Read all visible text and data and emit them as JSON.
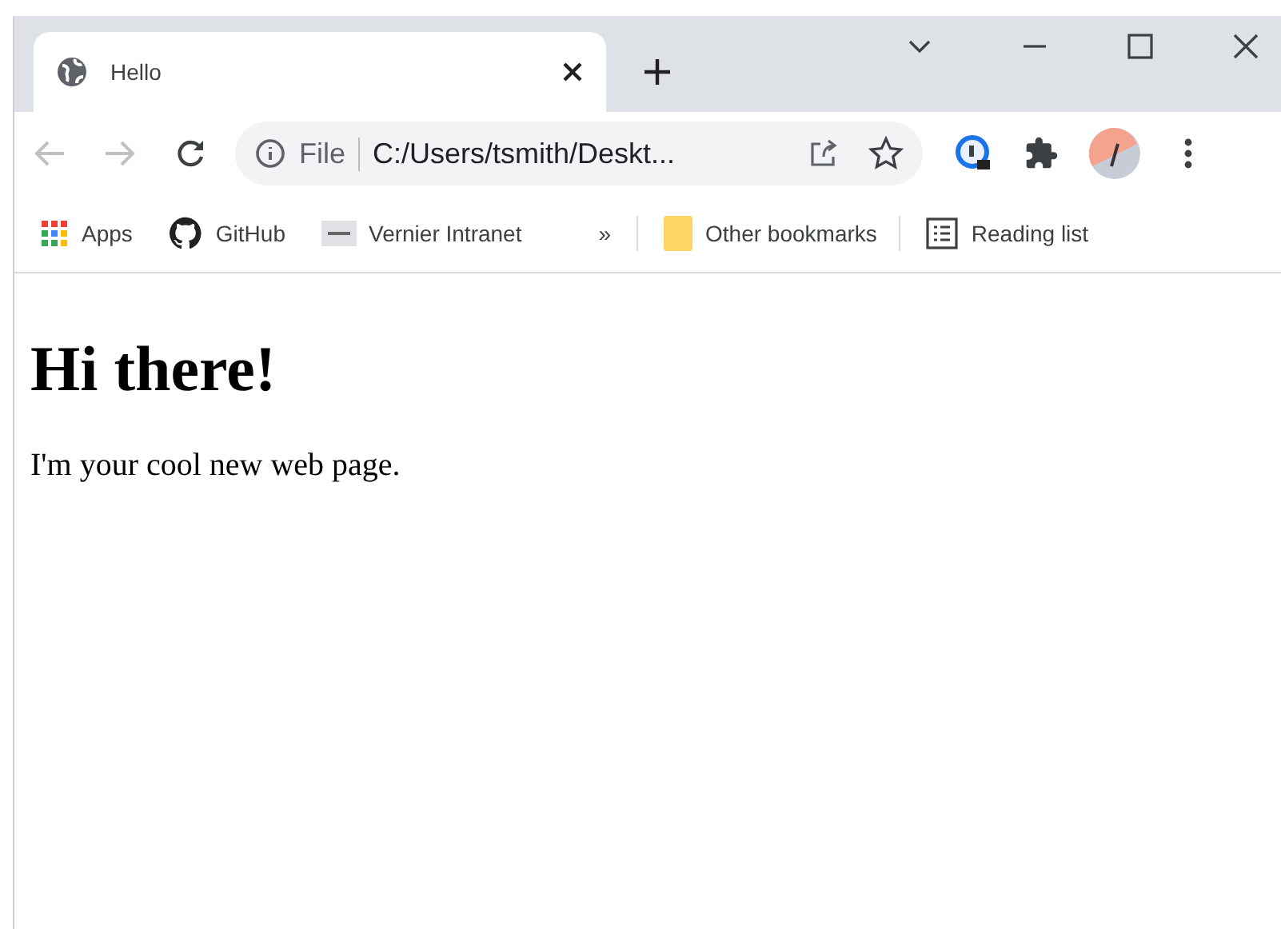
{
  "tab": {
    "title": "Hello",
    "selected": true
  },
  "address_bar": {
    "scheme": "File",
    "url": "C:/Users/tsmith/Deskt..."
  },
  "bookmarks": [
    {
      "kind": "apps",
      "label": "Apps"
    },
    {
      "kind": "github",
      "label": "GitHub"
    },
    {
      "kind": "site",
      "label": "Vernier Intranet"
    }
  ],
  "overflow": "»",
  "other_bookmarks": "Other bookmarks",
  "reading_list": "Reading list",
  "page": {
    "heading": "Hi there!",
    "paragraph": "I'm your cool new web page."
  }
}
